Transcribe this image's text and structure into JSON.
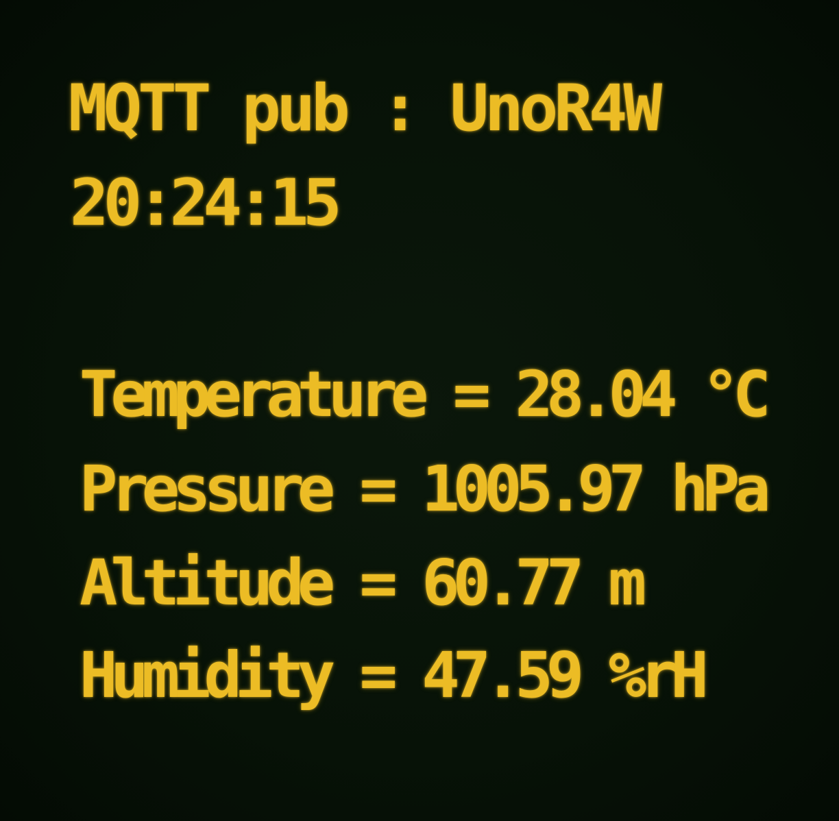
{
  "header": {
    "title": "MQTT pub : UnoR4W",
    "time": "20:24:15"
  },
  "readings": [
    {
      "label": "Temperature",
      "value": "28.04",
      "unit": "°C",
      "text": "Temperature = 28.04 °C"
    },
    {
      "label": "Pressure",
      "value": "1005.97",
      "unit": "hPa",
      "text": "Pressure = 1005.97 hPa"
    },
    {
      "label": "Altitude",
      "value": "60.77",
      "unit": "m",
      "text": "Altitude = 60.77 m"
    },
    {
      "label": "Humidity",
      "value": "47.59",
      "unit": "%rH",
      "text": "Humidity = 47.59 %rH"
    }
  ],
  "colors": {
    "text": "#ecbc25",
    "background": "#071207"
  }
}
